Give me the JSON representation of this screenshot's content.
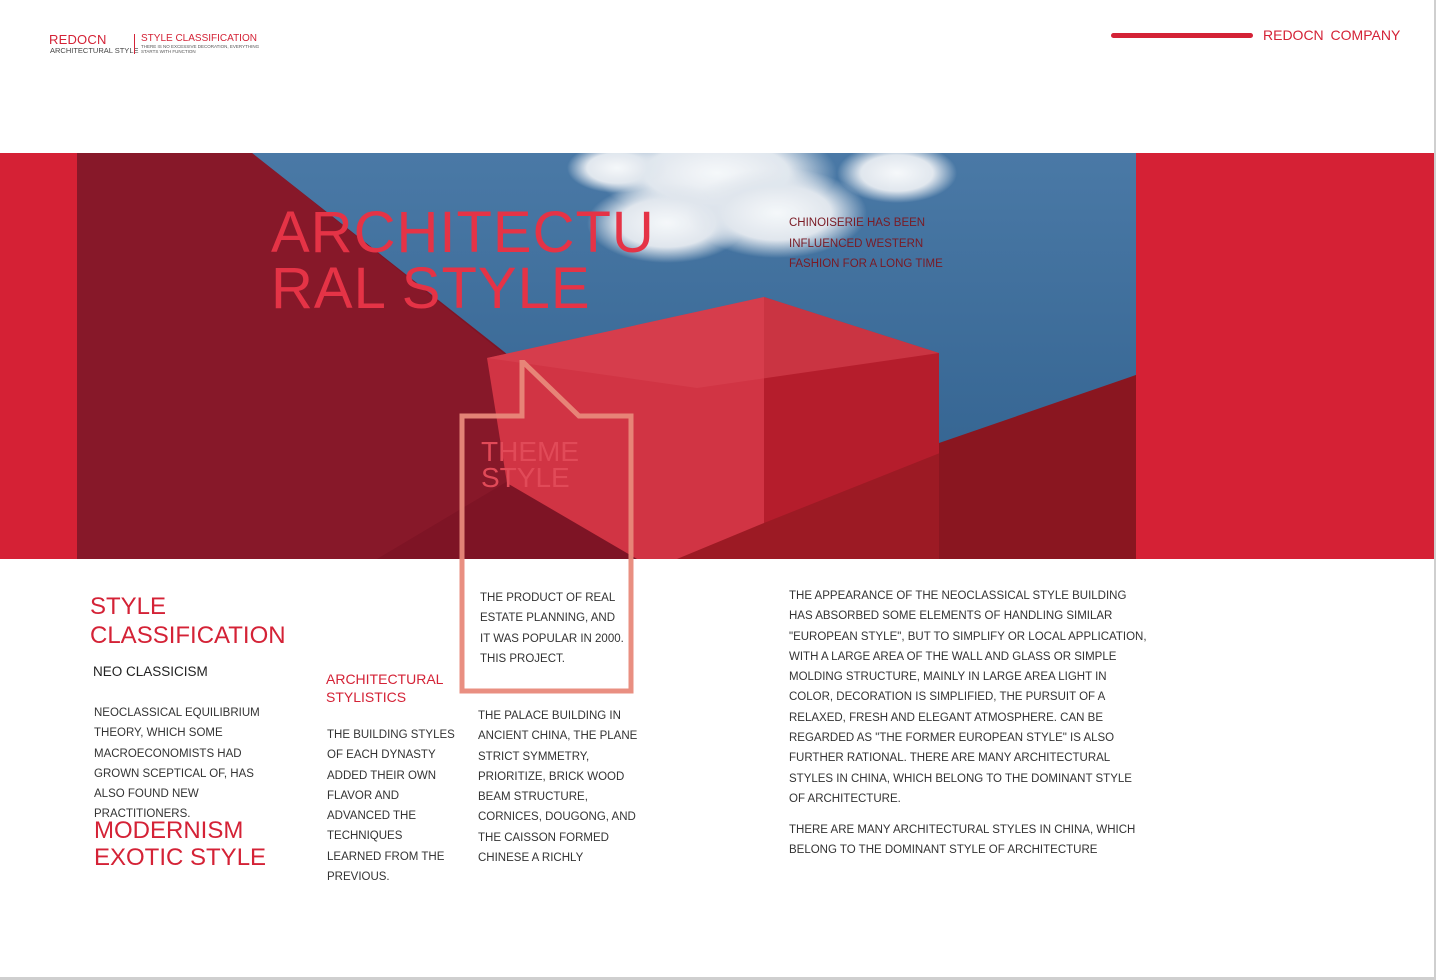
{
  "header": {
    "brand": "REDOCN",
    "brand_sub": "ARCHITECTURAL STYLE",
    "style_label": "STYLE CLASSIFICATION",
    "style_tagline": "THERE IS NO EXCESSIVE DECORATION, EVERYTHING STARTS WITH FUNCTION",
    "company": "REDOCN COMPANY"
  },
  "hero": {
    "title_line1": "ARCHITECTU",
    "title_line2": "RAL STYLE",
    "note": "CHINOISERIE HAS BEEN INFLUENCED WESTERN FASHION FOR A LONG TIME"
  },
  "theme": {
    "title_line1": "THEME",
    "title_line2": "STYLE",
    "body": "THE PRODUCT OF REAL ESTATE PLANNING, AND IT WAS POPULAR IN 2000. THIS PROJECT."
  },
  "style_classification": {
    "title_line1": "STYLE",
    "title_line2": "CLASSIFICATION",
    "subtitle": "NEO CLASSICISM",
    "body": "NEOCLASSICAL EQUILIBRIUM THEORY, WHICH SOME MACROECONOMISTS HAD GROWN SCEPTICAL OF, HAS ALSO FOUND NEW PRACTITIONERS.",
    "modern_line1": "MODERNISM",
    "modern_line2": "EXOTIC STYLE"
  },
  "architectural_stylistics": {
    "title_line1": "ARCHITECTURAL",
    "title_line2": "STYLISTICS",
    "body": "THE BUILDING STYLES OF EACH DYNASTY ADDED THEIR OWN FLAVOR AND ADVANCED THE TECHNIQUES LEARNED FROM THE PREVIOUS."
  },
  "palace": {
    "body": "THE PALACE BUILDING IN ANCIENT CHINA, THE PLANE STRICT SYMMETRY, PRIORITIZE, BRICK WOOD BEAM STRUCTURE, CORNICES, DOUGONG, AND THE CAISSON FORMED CHINESE A RICHLY"
  },
  "neoclassical": {
    "body": "THE APPEARANCE OF THE NEOCLASSICAL STYLE BUILDING HAS ABSORBED SOME ELEMENTS OF HANDLING SIMILAR \"EUROPEAN STYLE\", BUT TO SIMPLIFY OR LOCAL APPLICATION, WITH A LARGE AREA OF THE WALL AND GLASS OR SIMPLE MOLDING STRUCTURE, MAINLY IN LARGE AREA LIGHT IN COLOR, DECORATION IS SIMPLIFIED, THE PURSUIT OF A RELAXED, FRESH AND ELEGANT ATMOSPHERE. CAN BE REGARDED AS \"THE FORMER EUROPEAN STYLE\" IS ALSO FURTHER RATIONAL. THERE ARE MANY ARCHITECTURAL STYLES IN CHINA, WHICH BELONG TO THE DOMINANT STYLE OF ARCHITECTURE.",
    "body2": "THERE ARE MANY ARCHITECTURAL STYLES IN CHINA, WHICH BELONG TO THE DOMINANT STYLE OF ARCHITECTURE"
  },
  "colors": {
    "accent": "#d42236",
    "sky": "#3e6f9e",
    "frame": "#e8897a"
  },
  "images": {
    "banner": "red-building-sky-photo"
  }
}
